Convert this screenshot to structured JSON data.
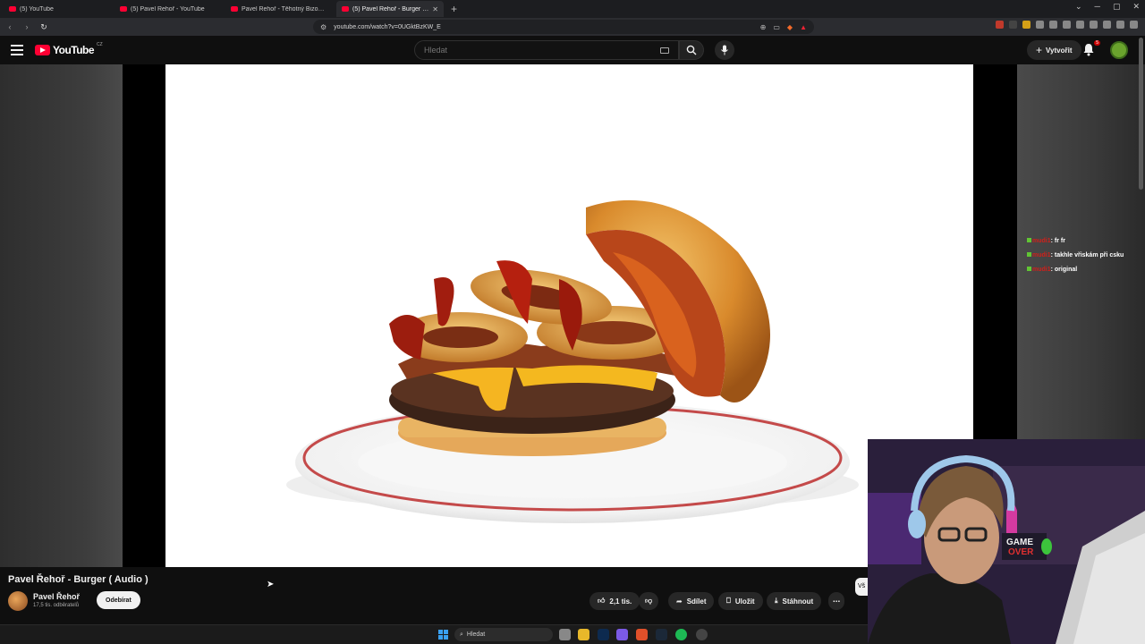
{
  "browser": {
    "tabs": [
      {
        "title": "(5) YouTube",
        "active": false
      },
      {
        "title": "(5) Pavel Řehoř - YouTube",
        "active": false
      },
      {
        "title": "Pavel Řehoř - Těhotný Bizon ( Audio",
        "active": false
      },
      {
        "title": "(5) Pavel Řehoř - Burger ( Audi",
        "active": true
      }
    ],
    "url": "youtube.com/watch?v=0UGktBzKW_E"
  },
  "youtube": {
    "logo_text": "YouTube",
    "country_code": "CZ",
    "search_placeholder": "Hledat",
    "create_label": "Vytvořit",
    "notification_count": "5"
  },
  "chat": [
    {
      "user": "mudi1",
      "message": ": fr fr"
    },
    {
      "user": "mudi1",
      "message": ": takhle vřiskám při csku"
    },
    {
      "user": "mudi1",
      "message": ": original"
    }
  ],
  "video": {
    "title": "Pavel Řehoř - Burger ( Audio )",
    "channel_name": "Pavel Řehoř",
    "subscribers": "17,5 tis. odběratelů",
    "subscribe_label": "Odebírat",
    "likes": "2,1 tis.",
    "share_label": "Sdílet",
    "save_label": "Uložit",
    "download_label": "Stáhnout",
    "side_chip": "Vš"
  },
  "webcam": {
    "sign_line1": "GAME",
    "sign_line2": "OVER"
  },
  "taskbar": {
    "search_label": "Hledat"
  },
  "colors": {
    "youtube_red": "#ff0033",
    "background": "#0f0f0f",
    "pill": "#272727"
  }
}
